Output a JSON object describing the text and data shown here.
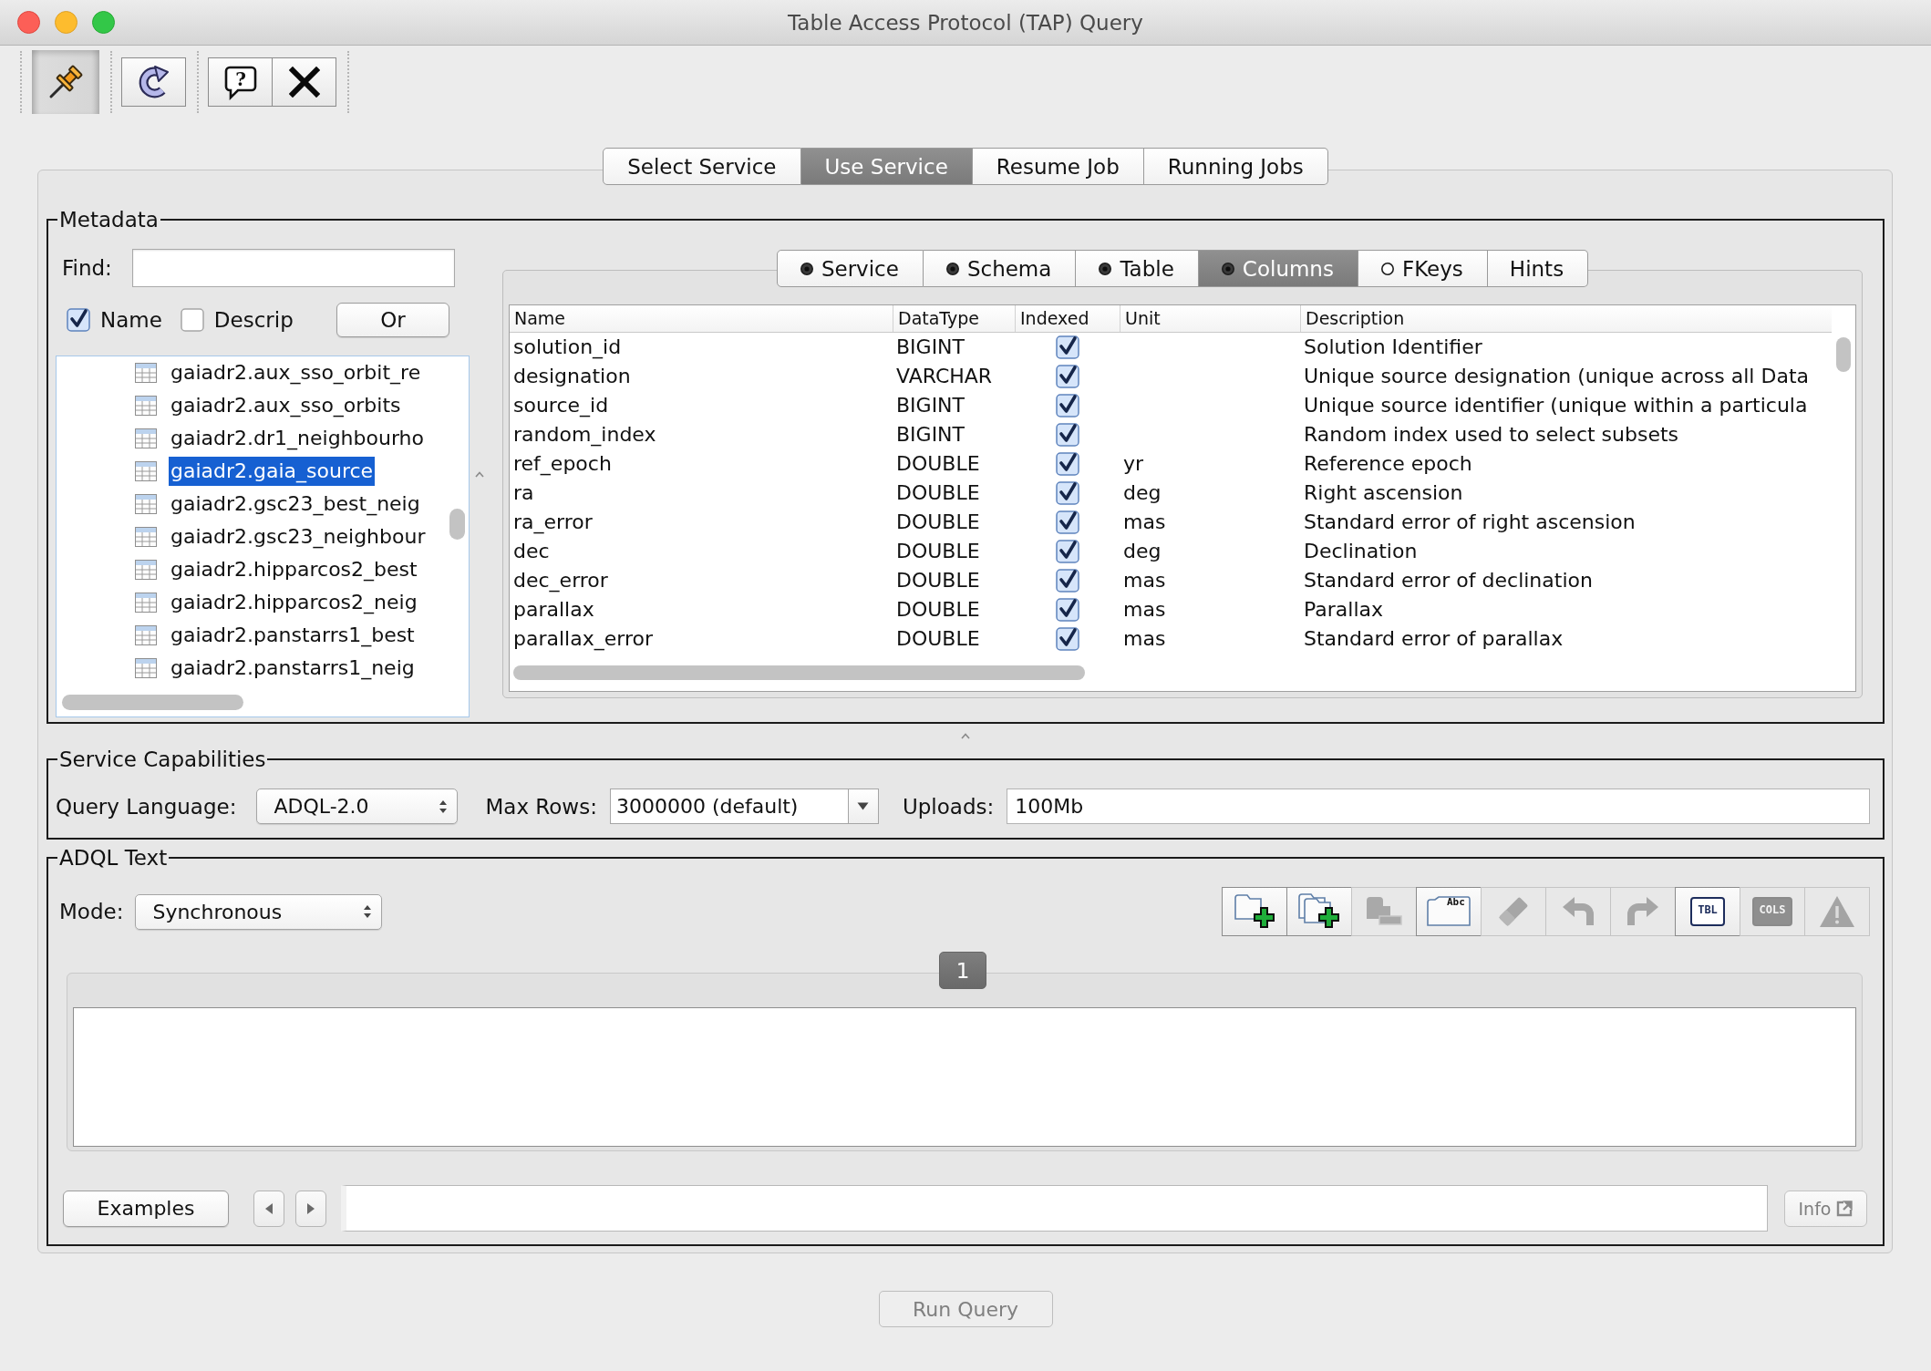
{
  "window": {
    "title": "Table Access Protocol (TAP) Query"
  },
  "toolbar": {
    "groups": [
      {
        "buttons": [
          {
            "kind": "pin",
            "pressed": true
          }
        ]
      },
      {
        "buttons": [
          {
            "kind": "refresh",
            "pressed": false
          }
        ]
      },
      {
        "buttons": [
          {
            "kind": "help",
            "pressed": false,
            "symbol": "?"
          },
          {
            "kind": "close",
            "pressed": false
          }
        ]
      }
    ]
  },
  "main_tabs": [
    {
      "label": "Select Service",
      "selected": false
    },
    {
      "label": "Use Service",
      "selected": true
    },
    {
      "label": "Resume Job",
      "selected": false
    },
    {
      "label": "Running Jobs",
      "selected": false
    }
  ],
  "metadata": {
    "title": "Metadata",
    "find": {
      "label": "Find:"
    },
    "filters": [
      {
        "label": "Name",
        "checked": true
      },
      {
        "label": "Descrip",
        "checked": false
      }
    ],
    "combine_button": "Or",
    "tree": [
      {
        "label": "gaiadr2.aux_sso_orbit_re",
        "selected": false
      },
      {
        "label": "gaiadr2.aux_sso_orbits",
        "selected": false
      },
      {
        "label": "gaiadr2.dr1_neighbourho",
        "selected": false
      },
      {
        "label": "gaiadr2.gaia_source",
        "selected": true
      },
      {
        "label": "gaiadr2.gsc23_best_neig",
        "selected": false
      },
      {
        "label": "gaiadr2.gsc23_neighbour",
        "selected": false
      },
      {
        "label": "gaiadr2.hipparcos2_best",
        "selected": false
      },
      {
        "label": "gaiadr2.hipparcos2_neig",
        "selected": false
      },
      {
        "label": "gaiadr2.panstarrs1_best",
        "selected": false
      },
      {
        "label": "gaiadr2.panstarrs1_neig",
        "selected": false
      }
    ],
    "tabs": [
      {
        "label": "Service",
        "selected": false,
        "loaded": true
      },
      {
        "label": "Schema",
        "selected": false,
        "loaded": true
      },
      {
        "label": "Table",
        "selected": false,
        "loaded": true
      },
      {
        "label": "Columns",
        "selected": true,
        "loaded": true
      },
      {
        "label": "FKeys",
        "selected": false,
        "loaded": false
      },
      {
        "label": "Hints",
        "selected": false
      }
    ],
    "table": {
      "columns": [
        "Name",
        "DataType",
        "Indexed",
        "Unit",
        "Description"
      ],
      "rows": [
        {
          "name": "solution_id",
          "datatype": "BIGINT",
          "indexed": true,
          "description": "Solution Identifier"
        },
        {
          "name": "designation",
          "datatype": "VARCHAR",
          "indexed": true,
          "description": "Unique source designation (unique across all Data"
        },
        {
          "name": "source_id",
          "datatype": "BIGINT",
          "indexed": true,
          "description": "Unique source identifier (unique within a particula"
        },
        {
          "name": "random_index",
          "datatype": "BIGINT",
          "indexed": true,
          "description": "Random index used to select subsets"
        },
        {
          "name": "ref_epoch",
          "datatype": "DOUBLE",
          "indexed": true,
          "unit": "yr",
          "description": "Reference epoch"
        },
        {
          "name": "ra",
          "datatype": "DOUBLE",
          "indexed": true,
          "unit": "deg",
          "description": "Right ascension"
        },
        {
          "name": "ra_error",
          "datatype": "DOUBLE",
          "indexed": true,
          "unit": "mas",
          "description": "Standard error of right ascension"
        },
        {
          "name": "dec",
          "datatype": "DOUBLE",
          "indexed": true,
          "unit": "deg",
          "description": "Declination"
        },
        {
          "name": "dec_error",
          "datatype": "DOUBLE",
          "indexed": true,
          "unit": "mas",
          "description": "Standard error of declination"
        },
        {
          "name": "parallax",
          "datatype": "DOUBLE",
          "indexed": true,
          "unit": "mas",
          "description": "Parallax"
        },
        {
          "name": "parallax_error",
          "datatype": "DOUBLE",
          "indexed": true,
          "unit": "mas",
          "description": "Standard error of parallax"
        }
      ]
    }
  },
  "service_capabilities": {
    "title": "Service Capabilities",
    "query_language": {
      "label": "Query Language:",
      "value": "ADQL-2.0"
    },
    "max_rows": {
      "label": "Max Rows:",
      "value": "3000000 (default)"
    },
    "uploads": {
      "label": "Uploads:",
      "value": "100Mb"
    }
  },
  "adql": {
    "title": "ADQL Text",
    "mode": {
      "label": "Mode:",
      "value": "Synchronous"
    },
    "tools": [
      {
        "kind": "add",
        "disabled": false
      },
      {
        "kind": "duplicate",
        "disabled": false
      },
      {
        "kind": "remove",
        "disabled": true
      },
      {
        "kind": "rename",
        "disabled": false,
        "label": "Abc"
      },
      {
        "kind": "erase",
        "disabled": true
      },
      {
        "kind": "undo",
        "disabled": true
      },
      {
        "kind": "redo",
        "disabled": true
      },
      {
        "kind": "tables",
        "disabled": false,
        "label": "TBL"
      },
      {
        "kind": "columns",
        "disabled": true,
        "label": "COLS"
      },
      {
        "kind": "warning",
        "disabled": true
      }
    ],
    "pages": [
      {
        "label": "1",
        "selected": true
      }
    ],
    "examples_button": "Examples",
    "info_button": {
      "label": "Info",
      "disabled": true
    }
  },
  "run_button": {
    "label": "Run Query",
    "disabled": true
  }
}
